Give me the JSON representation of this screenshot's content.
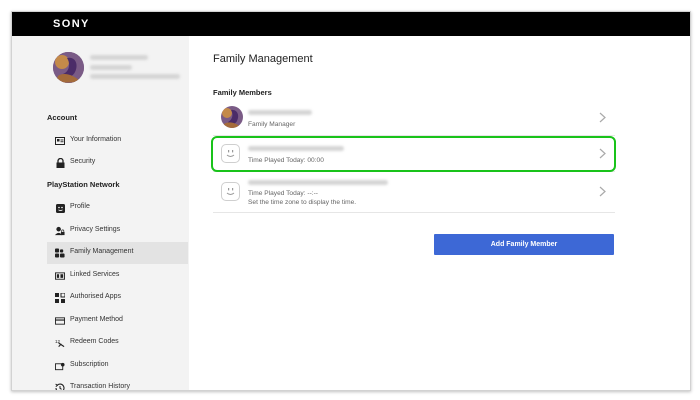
{
  "brand": "SONY",
  "sidebar": {
    "sections": [
      {
        "title": "Account",
        "items": [
          {
            "label": "Your Information",
            "icon": "id-card-icon"
          },
          {
            "label": "Security",
            "icon": "lock-icon"
          }
        ]
      },
      {
        "title": "PlayStation Network",
        "items": [
          {
            "label": "Profile",
            "icon": "profile-face-icon"
          },
          {
            "label": "Privacy Settings",
            "icon": "privacy-icon"
          },
          {
            "label": "Family Management",
            "icon": "family-icon",
            "active": true
          },
          {
            "label": "Linked Services",
            "icon": "linked-services-icon"
          },
          {
            "label": "Authorised Apps",
            "icon": "apps-icon"
          },
          {
            "label": "Payment Method",
            "icon": "credit-card-icon"
          },
          {
            "label": "Redeem Codes",
            "icon": "redeem-icon"
          },
          {
            "label": "Subscription",
            "icon": "subscription-icon"
          },
          {
            "label": "Transaction History",
            "icon": "history-icon"
          }
        ]
      }
    ]
  },
  "main": {
    "title": "Family Management",
    "members_heading": "Family Members",
    "members": [
      {
        "role": "Family Manager",
        "avatar": "user-avatar"
      },
      {
        "status": "Time Played Today: 00:00",
        "avatar": "child-face-icon",
        "highlighted": true
      },
      {
        "status": "Time Played Today: --:--",
        "note": "Set the time zone to display the time.",
        "avatar": "child-face-icon"
      }
    ],
    "add_button": "Add Family Member"
  },
  "colors": {
    "topbar": "#000000",
    "accent_button": "#3d68d6",
    "highlight_outline": "#19c31a",
    "sidebar_active": "#e3e3e3"
  }
}
